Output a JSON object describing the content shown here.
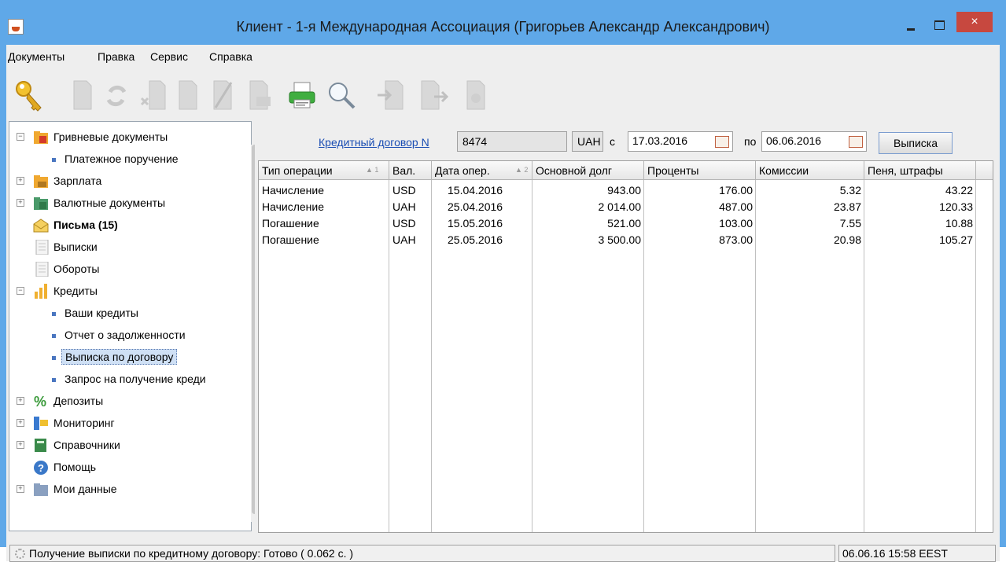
{
  "window": {
    "title": "Клиент - 1-я Международная Ассоциация (Григорьев Александр Александрович)",
    "close_label": "×"
  },
  "menu": [
    "Документы",
    "Правка",
    "Сервис",
    "Справка"
  ],
  "toolbar": {
    "buttons": [
      "key-icon",
      "new-document-icon",
      "refresh-icon",
      "delete-icon",
      "edit-icon",
      "sign-icon",
      "print-icon",
      "search-icon",
      "import-icon",
      "export-icon",
      "send-icon"
    ]
  },
  "tree": {
    "items": [
      {
        "label": "Гривневые документы",
        "toggle": "−"
      },
      {
        "label": "Платежное поручение"
      },
      {
        "label": "Зарплата",
        "toggle": "+"
      },
      {
        "label": "Валютные документы",
        "toggle": "+"
      },
      {
        "label": "Письма (15)"
      },
      {
        "label": "Выписки"
      },
      {
        "label": "Обороты"
      },
      {
        "label": "Кредиты",
        "toggle": "−"
      },
      {
        "label": "Ваши кредиты"
      },
      {
        "label": "Отчет о задолженности"
      },
      {
        "label": "Выписка по договору"
      },
      {
        "label": "Запрос на получение креди"
      },
      {
        "label": "Депозиты",
        "toggle": "+"
      },
      {
        "label": "Мониторинг",
        "toggle": "+"
      },
      {
        "label": "Справочники",
        "toggle": "+"
      },
      {
        "label": "Помощь"
      },
      {
        "label": "Мои данные",
        "toggle": "+"
      }
    ]
  },
  "filter": {
    "contract_link": "Кредитный договор N",
    "contract_number": "8474",
    "currency": "UAH",
    "from_label": "с",
    "from_date": "17.03.2016",
    "to_label": "по",
    "to_date": "06.06.2016",
    "statement_button": "Выписка"
  },
  "table": {
    "headers": [
      "Тип операции",
      "Вал.",
      "Дата опер.",
      "Основной долг",
      "Проценты",
      "Комиссии",
      "Пеня, штрафы"
    ],
    "sort_marks": [
      "▲ 1",
      "▲ 2"
    ],
    "rows": [
      [
        "Начисление",
        "USD",
        "15.04.2016",
        "943.00",
        "176.00",
        "5.32",
        "43.22"
      ],
      [
        "Начисление",
        "UAH",
        "25.04.2016",
        "2 014.00",
        "487.00",
        "23.87",
        "120.33"
      ],
      [
        "Погашение",
        "USD",
        "15.05.2016",
        "521.00",
        "103.00",
        "7.55",
        "10.88"
      ],
      [
        "Погашение",
        "UAH",
        "25.05.2016",
        "3 500.00",
        "873.00",
        "20.98",
        "105.27"
      ]
    ]
  },
  "status": {
    "message": "Получение выписки по кредитному договору: Готово ( 0.062 с. )",
    "datetime": "06.06.16 15:58 EEST"
  }
}
